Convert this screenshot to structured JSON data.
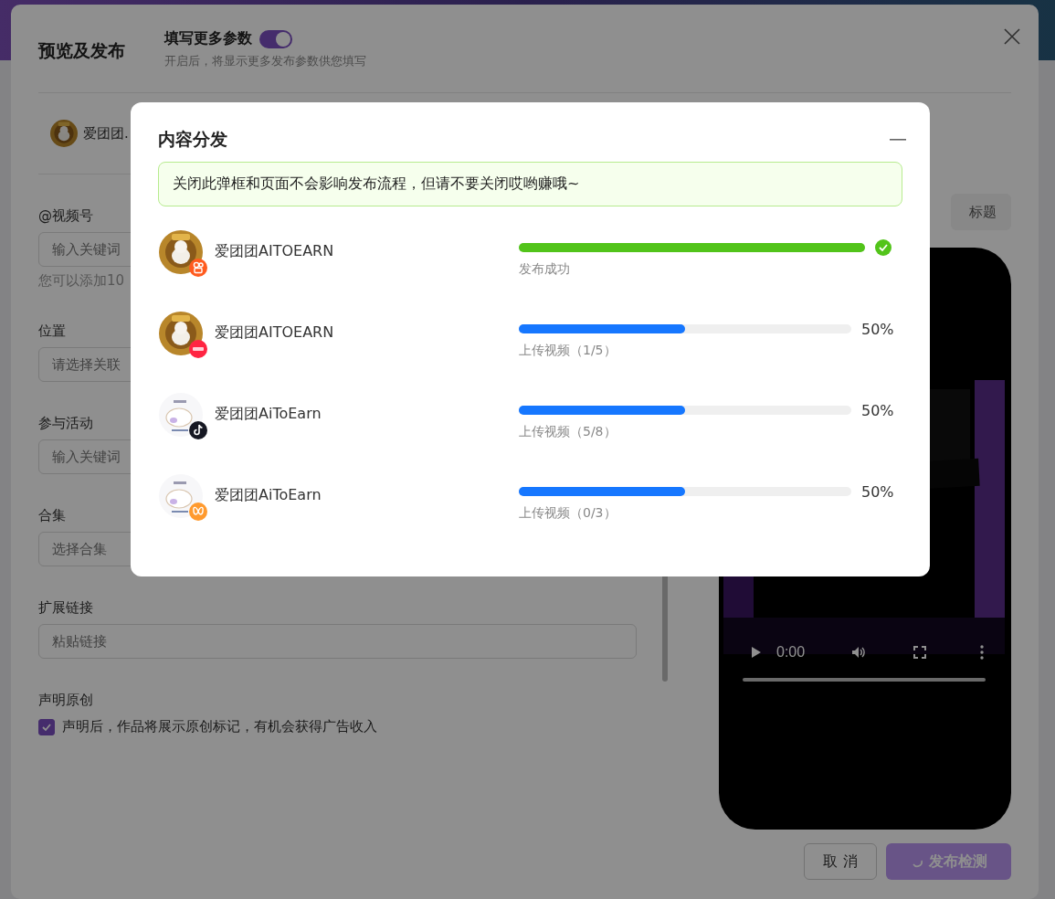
{
  "dialog": {
    "title": "预览及发布",
    "more_params": {
      "label": "填写更多参数",
      "on": true,
      "hint": "开启后，将显示更多发布参数供您填写"
    },
    "account": {
      "name": "爱团团."
    },
    "fields": [
      {
        "kind": "input",
        "label": "@视频号",
        "placeholder": "输入关键词",
        "hint": "您可以添加10"
      },
      {
        "kind": "input",
        "label": "位置",
        "placeholder": "请选择关联"
      },
      {
        "kind": "input",
        "label": "参与活动",
        "placeholder": "输入关键词"
      },
      {
        "kind": "input",
        "label": "合集",
        "placeholder": "选择合集"
      },
      {
        "kind": "input",
        "label": "扩展链接",
        "placeholder": "粘贴链接"
      },
      {
        "kind": "checkbox",
        "label": "声明原创",
        "text": "声明后，作品将展示原创标记，有机会获得广告收入",
        "checked": true
      }
    ],
    "preview": {
      "title_button": "标题",
      "time": "0:00"
    },
    "buttons": [
      {
        "kind": "default",
        "label": "取 消",
        "loading": false
      },
      {
        "kind": "primary",
        "label": "发布检测",
        "loading": true
      }
    ]
  },
  "modal": {
    "title": "内容分发",
    "notice": "关闭此弹框和页面不会影响发布流程，但请不要关闭哎哟赚哦~",
    "rows": [
      {
        "name": "爱团团AITOEARN",
        "kind": "kuaishou",
        "color": "#ff5b1f",
        "done": true,
        "level": 1,
        "caption": "发布成功"
      },
      {
        "name": "爱团团AITOEARN",
        "kind": "xiaohongshu",
        "color": "#ff2442",
        "done": false,
        "level": 0.5,
        "reading": "50%",
        "caption": "上传视频（1/5）"
      },
      {
        "name": "爱团团AiToEarn",
        "kind": "douyin",
        "color": "#161823",
        "done": false,
        "level": 0.5,
        "reading": "50%",
        "caption": "上传视频（5/8）"
      },
      {
        "name": "爱团团AiToEarn",
        "kind": "butterfly",
        "color": "#ff9a2e",
        "done": false,
        "level": 0.5,
        "reading": "50%",
        "caption": "上传视频（0/3）"
      }
    ]
  }
}
